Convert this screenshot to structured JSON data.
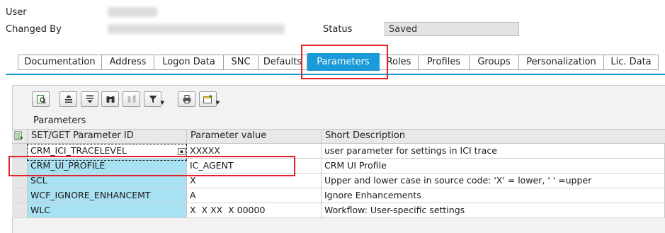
{
  "header": {
    "user_label": "User",
    "changed_by_label": "Changed By",
    "status_label": "Status",
    "status_value": "Saved"
  },
  "tabs": [
    {
      "label": "Documentation",
      "active": false
    },
    {
      "label": "Address",
      "active": false
    },
    {
      "label": "Logon Data",
      "active": false
    },
    {
      "label": "SNC",
      "active": false
    },
    {
      "label": "Defaults",
      "active": false
    },
    {
      "label": "Parameters",
      "active": true
    },
    {
      "label": "Roles",
      "active": false
    },
    {
      "label": "Profiles",
      "active": false
    },
    {
      "label": "Groups",
      "active": false
    },
    {
      "label": "Personalization",
      "active": false
    },
    {
      "label": "Lic. Data",
      "active": false
    }
  ],
  "toolbar": {
    "icons": [
      "details-icon",
      "sort-ascending-icon",
      "sort-descending-icon",
      "find-icon",
      "find-next-icon",
      "filter-icon",
      "print-icon",
      "export-icon"
    ]
  },
  "section": {
    "title": "Parameters"
  },
  "table": {
    "columns": [
      "SET/GET Parameter ID",
      "Parameter value",
      "Short Description"
    ],
    "rows": [
      {
        "id": "CRM_ICI_TRACELEVEL",
        "value": "XXXXX",
        "description": "user parameter for settings in ICI trace"
      },
      {
        "id": "CRM_UI_PROFILE",
        "value": "IC_AGENT",
        "description": "CRM UI Profile"
      },
      {
        "id": "SCL",
        "value": "X",
        "description": "Upper and lower case in source code: 'X' = lower, ' ' =upper"
      },
      {
        "id": "WCF_IGNORE_ENHANCEMT",
        "value": "A",
        "description": "Ignore Enhancements"
      },
      {
        "id": "WLC",
        "value": "X  X XX  X 00000",
        "description": "Workflow: User-specific settings"
      }
    ]
  },
  "colors": {
    "accent": "#1a9ad7",
    "param_id_cell": "#a8e1f2",
    "highlight_red": "#e0202a"
  }
}
